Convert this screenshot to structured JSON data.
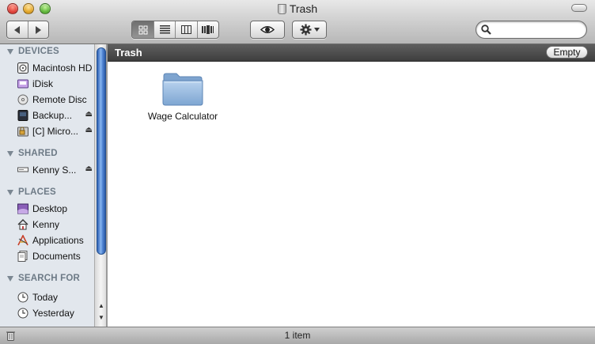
{
  "window": {
    "title": "Trash"
  },
  "toolbar": {
    "back_icon": "back-arrow-icon",
    "forward_icon": "forward-arrow-icon",
    "view_modes": [
      "icon-view-icon",
      "list-view-icon",
      "column-view-icon",
      "coverflow-view-icon"
    ],
    "active_view": 0,
    "quicklook_icon": "eye-icon",
    "action_icon": "gear-icon",
    "search_placeholder": "",
    "search_value": ""
  },
  "sidebar": {
    "sections": [
      {
        "label": "DEVICES",
        "items": [
          {
            "label": "Macintosh HD",
            "icon": "hard-disk-icon",
            "eject": false
          },
          {
            "label": "iDisk",
            "icon": "idisk-icon",
            "eject": false
          },
          {
            "label": "Remote Disc",
            "icon": "remote-disc-icon",
            "eject": false
          },
          {
            "label": "Backup...",
            "icon": "external-drive-icon",
            "eject": true
          },
          {
            "label": "[C] Micro...",
            "icon": "locked-drive-icon",
            "eject": true
          }
        ]
      },
      {
        "label": "SHARED",
        "items": [
          {
            "label": "Kenny S...",
            "icon": "network-computer-icon",
            "eject": true
          }
        ]
      },
      {
        "label": "PLACES",
        "items": [
          {
            "label": "Desktop",
            "icon": "desktop-icon",
            "eject": false
          },
          {
            "label": "Kenny",
            "icon": "home-icon",
            "eject": false
          },
          {
            "label": "Applications",
            "icon": "applications-icon",
            "eject": false
          },
          {
            "label": "Documents",
            "icon": "documents-icon",
            "eject": false
          }
        ]
      },
      {
        "label": "SEARCH FOR",
        "items": [
          {
            "label": "Today",
            "icon": "clock-icon",
            "eject": false
          },
          {
            "label": "Yesterday",
            "icon": "clock-icon",
            "eject": false
          }
        ]
      }
    ]
  },
  "main": {
    "path_title": "Trash",
    "empty_button": "Empty",
    "files": [
      {
        "name": "Wage Calculator",
        "icon": "folder-icon"
      }
    ]
  },
  "status": {
    "text": "1 item"
  },
  "colors": {
    "sidebar_bg": "#e2e7ed",
    "section_header": "#6d7a86",
    "path_bar": "#4a4a4a",
    "folder_blue": "#8fb3d9"
  }
}
